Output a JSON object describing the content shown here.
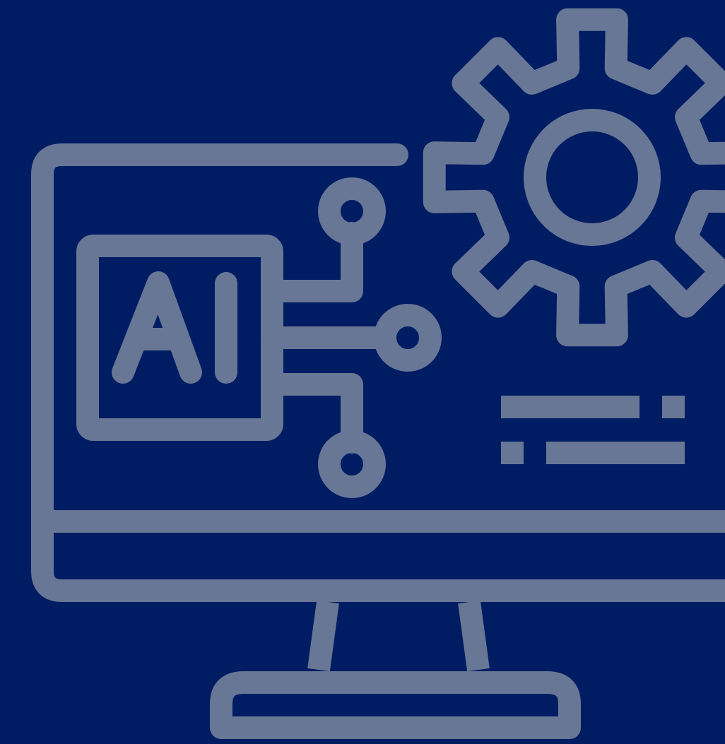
{
  "illustration": {
    "chip_label": "AI",
    "icon_names": [
      "monitor-icon",
      "gear-icon",
      "ai-chip-icon",
      "circuit-icon",
      "text-lines-icon"
    ]
  },
  "colors": {
    "background": "#001c62",
    "line": "#687796"
  }
}
